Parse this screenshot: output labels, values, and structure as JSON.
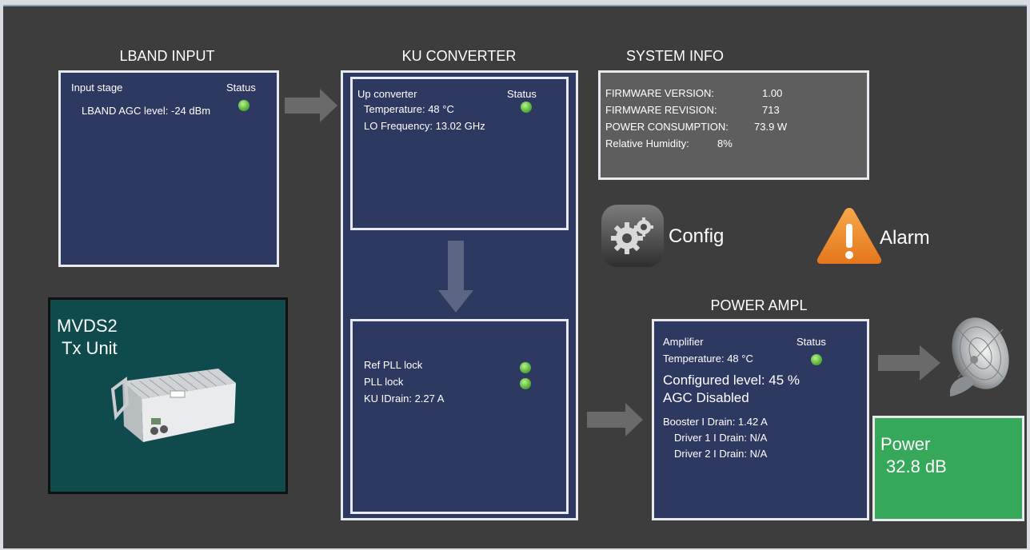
{
  "lband": {
    "title": "LBAND INPUT",
    "stage": "Input stage",
    "status_label": "Status",
    "agc": "LBAND AGC level: -24 dBm"
  },
  "ku": {
    "title": "KU CONVERTER",
    "upconverter": "Up converter",
    "status_label": "Status",
    "temperature": "Temperature: 48 °C",
    "lo_freq": "LO Frequency: 13.02 GHz",
    "ref_pll": "Ref PLL lock",
    "pll": "PLL lock",
    "idrain": "KU IDrain: 2.27 A"
  },
  "sysinfo": {
    "title": "SYSTEM INFO",
    "rows": [
      {
        "label": "FIRMWARE VERSION:",
        "value": "1.00"
      },
      {
        "label": "FIRMWARE REVISION:",
        "value": "713"
      },
      {
        "label": "POWER CONSUMPTION:",
        "value": "73.9 W"
      },
      {
        "label": "Relative Humidity:",
        "value": "8%"
      }
    ]
  },
  "buttons": {
    "config": "Config",
    "alarm": "Alarm"
  },
  "mvds": {
    "line1": "MVDS2",
    "line2": "Tx Unit"
  },
  "pa": {
    "title": "POWER AMPL",
    "amplifier": "Amplifier",
    "status_label": "Status",
    "temperature": "Temperature: 48 °C",
    "configured": "Configured level: 45 %",
    "agc": "AGC Disabled",
    "booster": "Booster I Drain: 1.42 A",
    "driver1": "Driver 1 I Drain: N/A",
    "driver2": "Driver 2 I Drain: N/A"
  },
  "power": {
    "label": "Power",
    "value": "32.8 dB"
  },
  "colors": {
    "panel": "#2e3962",
    "background": "#3d3d3d",
    "led_ok": "#59b33a",
    "power_box": "#36a85a",
    "alarm": "#f08a24"
  },
  "icons": [
    "gear-icon",
    "warning-icon",
    "satellite-dish-icon",
    "transmitter-unit-image"
  ]
}
